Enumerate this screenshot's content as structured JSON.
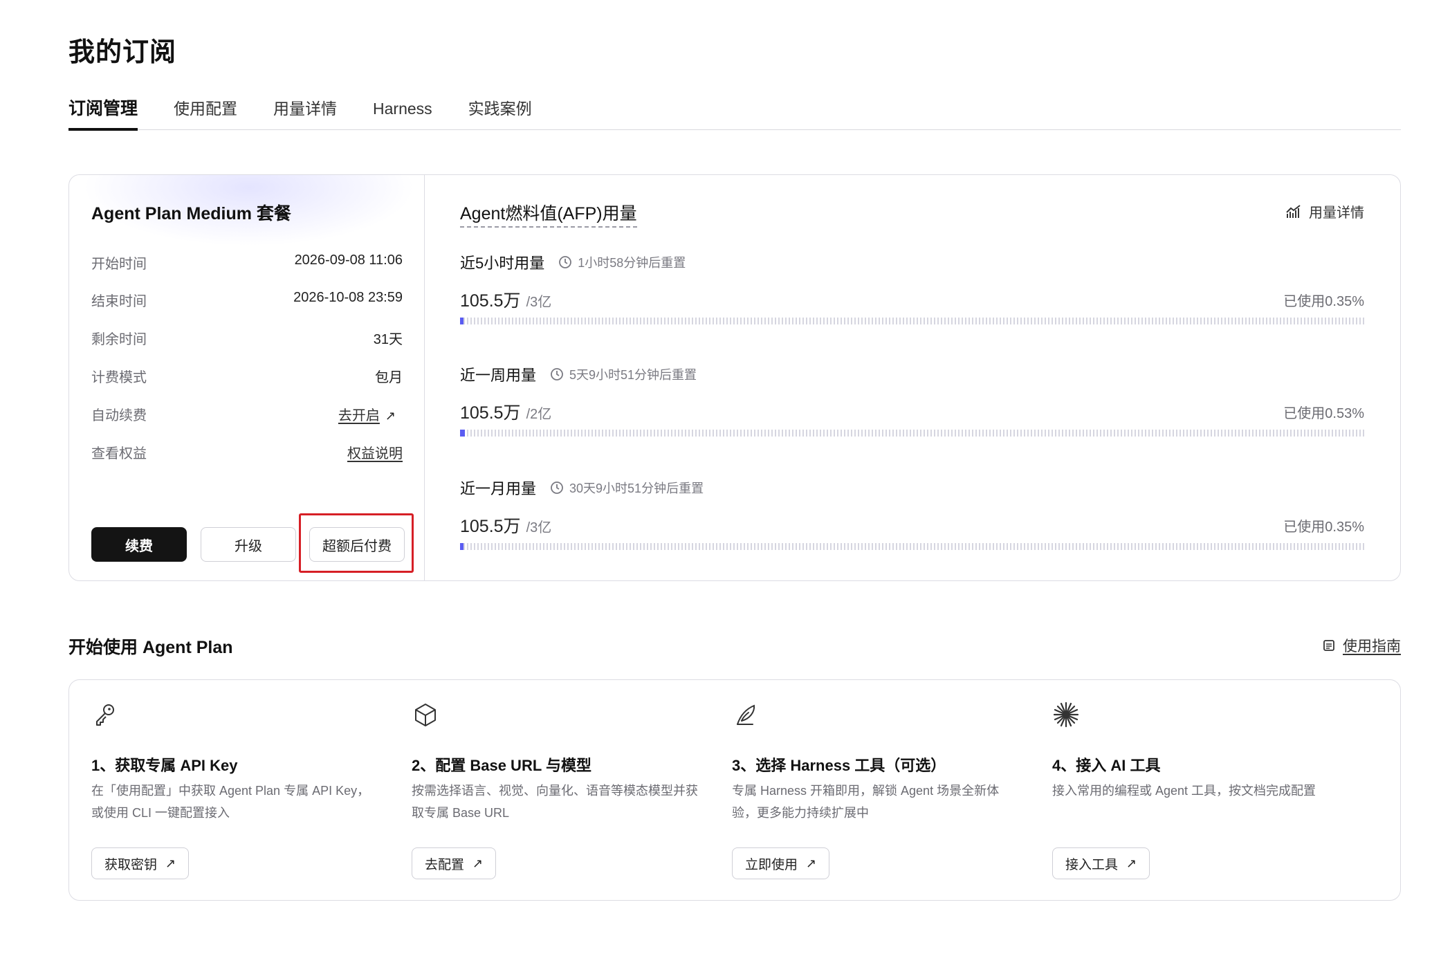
{
  "page_title": "我的订阅",
  "tabs": [
    {
      "label": "订阅管理",
      "active": true
    },
    {
      "label": "使用配置",
      "active": false
    },
    {
      "label": "用量详情",
      "active": false
    },
    {
      "label": "Harness",
      "active": false
    },
    {
      "label": "实践案例",
      "active": false
    }
  ],
  "plan": {
    "name": "Agent Plan Medium 套餐",
    "rows": [
      {
        "label": "开始时间",
        "value": "2026-09-08 11:06"
      },
      {
        "label": "结束时间",
        "value": "2026-10-08 23:59"
      },
      {
        "label": "剩余时间",
        "value": "31天"
      },
      {
        "label": "计费模式",
        "value": "包月"
      },
      {
        "label": "自动续费",
        "value": "去开启"
      },
      {
        "label": "查看权益",
        "value": "权益说明"
      }
    ],
    "buttons": {
      "renew": "续费",
      "upgrade": "升级",
      "overage": "超额后付费"
    }
  },
  "usage": {
    "title": "Agent燃料值(AFP)用量",
    "detail_link": "用量详情",
    "blocks": [
      {
        "label": "近5小时用量",
        "reset": "1小时58分钟后重置",
        "amount": "105.5万",
        "total": "/3亿",
        "percent_text": "已使用0.35%",
        "percent": 0.35
      },
      {
        "label": "近一周用量",
        "reset": "5天9小时51分钟后重置",
        "amount": "105.5万",
        "total": "/2亿",
        "percent_text": "已使用0.53%",
        "percent": 0.53
      },
      {
        "label": "近一月用量",
        "reset": "30天9小时51分钟后重置",
        "amount": "105.5万",
        "total": "/3亿",
        "percent_text": "已使用0.35%",
        "percent": 0.35
      }
    ]
  },
  "start": {
    "title": "开始使用 Agent Plan",
    "guide_link": "使用指南",
    "steps": [
      {
        "icon": "key-icon",
        "title": "1、获取专属 API Key",
        "desc": "在「使用配置」中获取 Agent Plan 专属 API Key，或使用 CLI 一键配置接入",
        "button": "获取密钥"
      },
      {
        "icon": "cube-icon",
        "title": "2、配置 Base URL 与模型",
        "desc": "按需选择语言、视觉、向量化、语音等模态模型并获取专属 Base URL",
        "button": "去配置"
      },
      {
        "icon": "feather-icon",
        "title": "3、选择 Harness 工具（可选）",
        "desc": "专属 Harness 开箱即用，解锁 Agent 场景全新体验，更多能力持续扩展中",
        "button": "立即使用"
      },
      {
        "icon": "sparkle-icon",
        "title": "4、接入 AI 工具",
        "desc": "接入常用的编程或 Agent 工具，按文档完成配置",
        "button": "接入工具"
      }
    ]
  },
  "colors": {
    "accent": "#5a5cf2",
    "primary_button": "#141414",
    "highlight": "#d61f26"
  }
}
